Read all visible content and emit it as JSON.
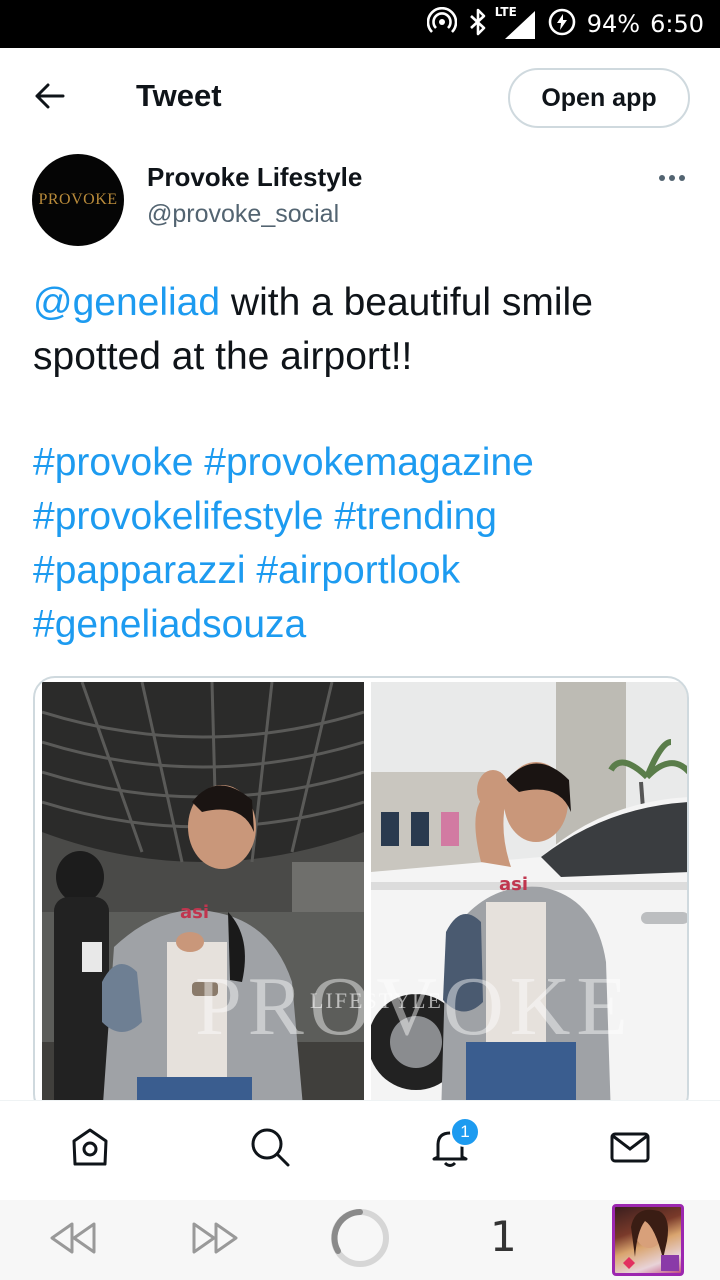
{
  "status_bar": {
    "network": "LTE",
    "battery": "94%",
    "time": "6:50"
  },
  "header": {
    "title": "Tweet",
    "open_app_label": "Open app"
  },
  "author": {
    "avatar_text": "PROVOKE",
    "name": "Provoke Lifestyle",
    "handle": "@provoke_social"
  },
  "tweet": {
    "mention": "@geneliad",
    "text": " with a beautiful smile spotted at the airport!!",
    "hashtags": [
      "#provoke",
      "#provokemagazine",
      "#provokelifestyle",
      "#trending",
      "#papparazzi",
      "#airportlook",
      "#geneliadsouza"
    ]
  },
  "media": {
    "watermark": "PROVOKE",
    "watermark_sub": "LIFESTYLE",
    "left_shirt_text": "asi",
    "right_shirt_text": "asi"
  },
  "bottom_nav": {
    "notifications_badge": "1"
  },
  "browser_bar": {
    "tab_count": "1"
  },
  "colors": {
    "link": "#1d9bf0",
    "text_primary": "#0f1419",
    "text_secondary": "#536471",
    "border": "#cfd9de"
  },
  "icons": [
    "hotspot-icon",
    "bluetooth-icon",
    "signal-icon",
    "battery-saver-icon",
    "back-arrow-icon",
    "more-icon",
    "home-icon",
    "search-icon",
    "bell-icon",
    "mail-icon",
    "rewind-icon",
    "fast-forward-icon",
    "loading-icon"
  ]
}
